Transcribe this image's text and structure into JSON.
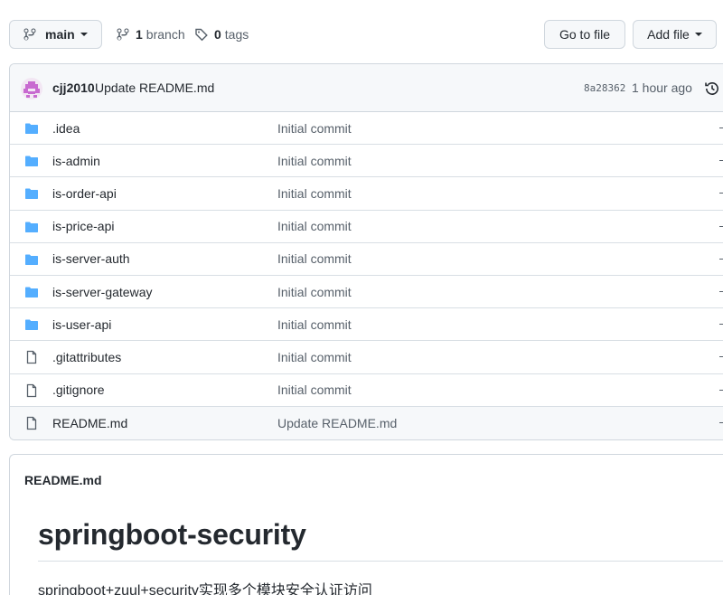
{
  "toolbar": {
    "branch_label": "main",
    "branch_count": "1",
    "branch_word": "branch",
    "tag_count": "0",
    "tag_word": "tags",
    "goto_label": "Go to file",
    "add_label": "Add file"
  },
  "latest_commit": {
    "author": "cjj2010",
    "message": "Update README.md",
    "sha": "8a28362",
    "time": "1 hour ago"
  },
  "files": [
    {
      "type": "folder",
      "name": ".idea",
      "message": "Initial commit"
    },
    {
      "type": "folder",
      "name": "is-admin",
      "message": "Initial commit"
    },
    {
      "type": "folder",
      "name": "is-order-api",
      "message": "Initial commit"
    },
    {
      "type": "folder",
      "name": "is-price-api",
      "message": "Initial commit"
    },
    {
      "type": "folder",
      "name": "is-server-auth",
      "message": "Initial commit"
    },
    {
      "type": "folder",
      "name": "is-server-gateway",
      "message": "Initial commit"
    },
    {
      "type": "folder",
      "name": "is-user-api",
      "message": "Initial commit"
    },
    {
      "type": "file",
      "name": ".gitattributes",
      "message": "Initial commit"
    },
    {
      "type": "file",
      "name": ".gitignore",
      "message": "Initial commit"
    },
    {
      "type": "file",
      "name": "README.md",
      "message": "Update README.md"
    }
  ],
  "readme": {
    "filename": "README.md",
    "heading": "springboot-security",
    "paragraph": "springboot+zuul+security实现多个模块安全认证访问"
  },
  "colors": {
    "folder": "#54aeff",
    "file": "#57606a",
    "border": "#d0d7de"
  }
}
